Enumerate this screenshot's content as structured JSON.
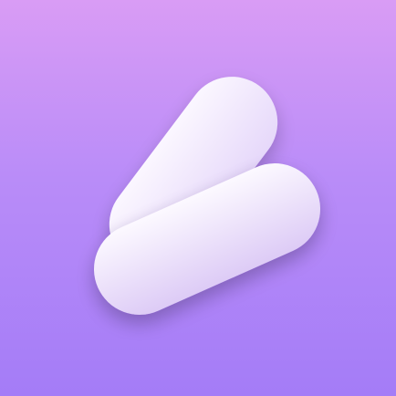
{
  "icon": {
    "name": "pill-heart-logo",
    "colors": {
      "background_top": "#d99cf5",
      "background_bottom": "#a47cf7",
      "pill_light": "#fbf7ff",
      "pill_mid": "#ece1fb",
      "pill_shade": "#d7c4f4"
    }
  }
}
